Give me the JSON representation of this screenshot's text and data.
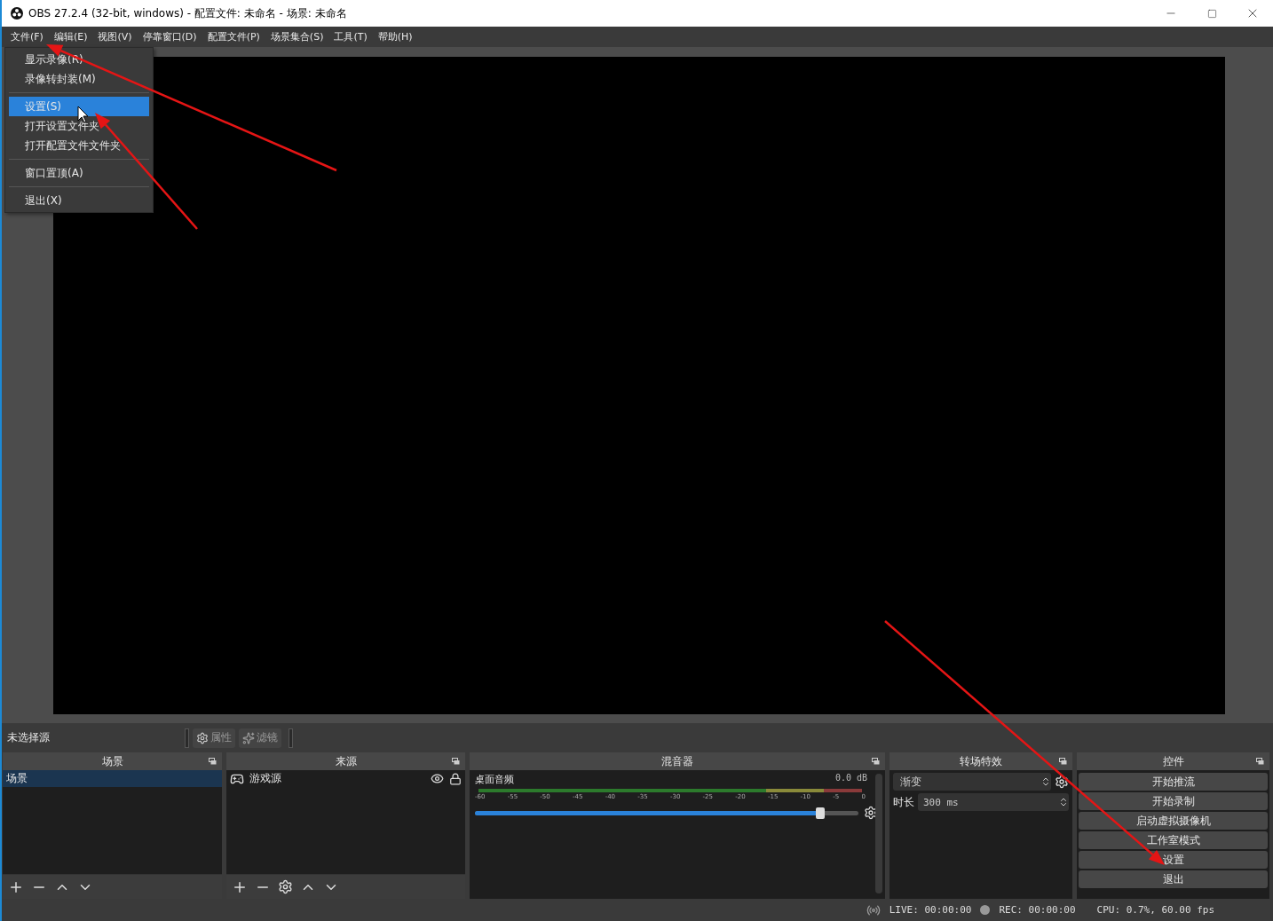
{
  "window": {
    "title": "OBS 27.2.4 (32-bit, windows) - 配置文件: 未命名 - 场景: 未命名"
  },
  "menu_bar": [
    {
      "label": "文件(F)"
    },
    {
      "label": "编辑(E)"
    },
    {
      "label": "视图(V)"
    },
    {
      "label": "停靠窗口(D)"
    },
    {
      "label": "配置文件(P)"
    },
    {
      "label": "场景集合(S)"
    },
    {
      "label": "工具(T)"
    },
    {
      "label": "帮助(H)"
    }
  ],
  "file_menu": {
    "items": [
      {
        "kind": "item",
        "label": "显示录像(R)",
        "selected": false
      },
      {
        "kind": "item",
        "label": "录像转封装(M)",
        "selected": false
      },
      {
        "kind": "separator"
      },
      {
        "kind": "item",
        "label": "设置(S)",
        "selected": true
      },
      {
        "kind": "item",
        "label": "打开设置文件夹",
        "selected": false
      },
      {
        "kind": "item",
        "label": "打开配置文件文件夹",
        "selected": false
      },
      {
        "kind": "separator"
      },
      {
        "kind": "item",
        "label": "窗口置顶(A)",
        "selected": false
      },
      {
        "kind": "separator"
      },
      {
        "kind": "item",
        "label": "退出(X)",
        "selected": false
      }
    ]
  },
  "source_toolbar": {
    "label": "未选择源",
    "buttons": [
      {
        "label": "属性"
      },
      {
        "label": "滤镜"
      }
    ]
  },
  "scenes": {
    "title": "场景",
    "items": [
      {
        "label": "场景",
        "selected": true
      }
    ]
  },
  "sources": {
    "title": "来源",
    "items": [
      {
        "label": "游戏源"
      }
    ]
  },
  "mixer": {
    "title": "混音器",
    "channels": [
      {
        "name": "桌面音频",
        "reading": "0.0 dB",
        "level": 0.9,
        "ticks": [
          "-60",
          "-55",
          "-50",
          "-45",
          "-40",
          "-35",
          "-30",
          "-25",
          "-20",
          "-15",
          "-10",
          "-5",
          "0"
        ]
      }
    ]
  },
  "transitions": {
    "title": "转场特效",
    "transition": "渐变",
    "duration_label": "时长",
    "duration": "300 ms"
  },
  "controls": {
    "title": "控件",
    "buttons": [
      {
        "label": "开始推流"
      },
      {
        "label": "开始录制"
      },
      {
        "label": "启动虚拟摄像机"
      },
      {
        "label": "工作室模式"
      },
      {
        "label": "设置"
      },
      {
        "label": "退出"
      }
    ]
  },
  "status_bar": {
    "live": "LIVE: 00:00:00",
    "rec": "REC: 00:00:00",
    "cpu": "CPU: 0.7%, 60.00 fps"
  }
}
